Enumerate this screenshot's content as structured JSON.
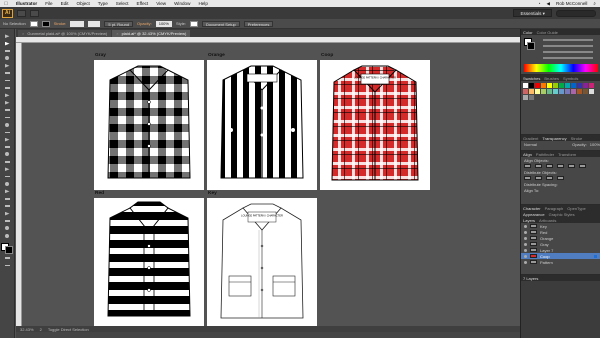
{
  "menubar": {
    "app": "Illustrator",
    "items": [
      "File",
      "Edit",
      "Object",
      "Type",
      "Select",
      "Effect",
      "View",
      "Window",
      "Help"
    ],
    "user": "Rob McConnell"
  },
  "appbar": {
    "logo": "Ai",
    "workspace": "Essentials ▾"
  },
  "control": {
    "selection": "No Selection",
    "stroke_label": "Stroke:",
    "brush": "5 pt. Round",
    "opacity_label": "Opacity:",
    "opacity_value": "100%",
    "style_label": "Style:",
    "document_setup": "Document Setup",
    "preferences": "Preferences"
  },
  "tabs": [
    {
      "label": "Gunmetal plaid.ai* @ 100% (CMYK/Preview)",
      "active": false
    },
    {
      "label": "plaid.ai* @ 32.43% (CMYK/Preview)",
      "active": true
    }
  ],
  "tab_close": "×",
  "window_title": "plaid.ai* @ 32.43% (CMYK/Preview)",
  "artboards": {
    "gray": "Gray",
    "orange": "Orange",
    "coop": "Coop",
    "red": "Red",
    "key": "Key"
  },
  "shirt_tag_text": "LOUNGE PATTERN / CHARACTER",
  "status": {
    "zoom": "32.43%",
    "page": "2",
    "tool": "Toggle Direct Selection"
  },
  "panels": {
    "color": {
      "tab": "Color",
      "tab2": "Color Guide"
    },
    "swatches": {
      "tab": "Swatches",
      "tab2": "Brushes",
      "tab3": "Symbols"
    },
    "stroke": {
      "tab": "Gradient",
      "tab2": "Transparency",
      "tab3": "Stroke"
    },
    "blend": {
      "mode": "Normal",
      "opacity_label": "Opacity:",
      "opacity": "100%"
    },
    "align": {
      "tab": "Align",
      "tab2": "Pathfinder",
      "tab3": "Transform",
      "align_objects": "Align Objects:",
      "distribute_objects": "Distribute Objects:",
      "distribute_spacing": "Distribute Spacing:",
      "align_to": "Align To:"
    },
    "character": {
      "tab": "Character",
      "tab2": "Paragraph",
      "tab3": "OpenType"
    },
    "appearance": {
      "tab": "Appearance",
      "tab2": "Graphic Styles"
    },
    "layers": {
      "tab": "Layers",
      "tab2": "Artboards",
      "items": [
        "Key",
        "Red",
        "Orange",
        "Gray",
        "Layer 7",
        "Coop",
        "Pattern"
      ],
      "footer": "7 Layers"
    }
  }
}
